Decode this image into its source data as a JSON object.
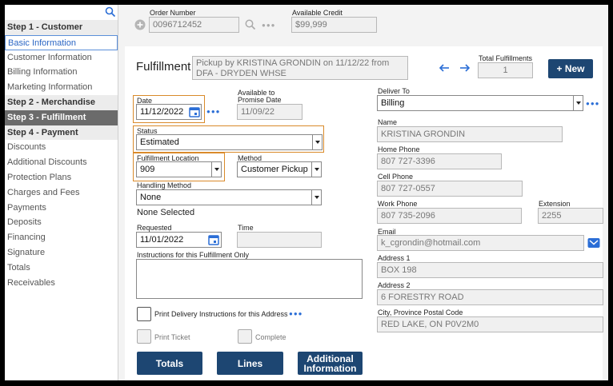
{
  "sidebar": {
    "items": [
      {
        "label": "Step 1 - Customer",
        "kind": "step"
      },
      {
        "label": "Basic Information",
        "kind": "selected"
      },
      {
        "label": "Customer Information",
        "kind": "item"
      },
      {
        "label": "Billing Information",
        "kind": "item"
      },
      {
        "label": "Marketing Information",
        "kind": "item"
      },
      {
        "label": "Step 2 - Merchandise",
        "kind": "step"
      },
      {
        "label": "Step 3 - Fulfillment",
        "kind": "active-step"
      },
      {
        "label": "Step 4 - Payment",
        "kind": "step"
      },
      {
        "label": "Discounts",
        "kind": "item"
      },
      {
        "label": "Additional Discounts",
        "kind": "item"
      },
      {
        "label": "Protection Plans",
        "kind": "item"
      },
      {
        "label": "Charges and Fees",
        "kind": "item"
      },
      {
        "label": "Payments",
        "kind": "item"
      },
      {
        "label": "Deposits",
        "kind": "item"
      },
      {
        "label": "Financing",
        "kind": "item"
      },
      {
        "label": "Signature",
        "kind": "item"
      },
      {
        "label": "Totals",
        "kind": "item"
      },
      {
        "label": "Receivables",
        "kind": "item"
      }
    ]
  },
  "header": {
    "order_number_label": "Order Number",
    "order_number": "0096712452",
    "available_credit_label": "Available Credit",
    "available_credit": "$99,999"
  },
  "fulfillment": {
    "title": "Fulfillment",
    "description": "Pickup by KRISTINA GRONDIN on 11/12/22 from DFA - DRYDEN WHSE",
    "total_label": "Total Fulfillments",
    "total": "1",
    "new_button": "+ New"
  },
  "form": {
    "date_label": "Date",
    "date": "11/12/2022",
    "promise_label_1": "Available to",
    "promise_label_2": "Promise Date",
    "promise_date": "11/09/22",
    "status_label": "Status",
    "status": "Estimated",
    "location_label": "Fulfillment Location",
    "location": "909",
    "method_label": "Method",
    "method": "Customer Pickup",
    "handling_label": "Handling Method",
    "handling": "None",
    "none_selected": "None Selected",
    "requested_label": "Requested",
    "requested": "11/01/2022",
    "time_label": "Time",
    "time": "",
    "instructions_label": "Instructions for this Fulfillment Only",
    "print_delivery_label": "Print Delivery Instructions for this Address",
    "print_ticket_label": "Print Ticket",
    "complete_label": "Complete"
  },
  "deliver": {
    "deliver_to_label": "Deliver To",
    "deliver_to": "Billing",
    "name_label": "Name",
    "name": "KRISTINA GRONDIN",
    "home_phone_label": "Home Phone",
    "home_phone": "807 727-3396",
    "cell_phone_label": "Cell Phone",
    "cell_phone": "807 727-0557",
    "work_phone_label": "Work Phone",
    "work_phone": "807 735-2096",
    "extension_label": "Extension",
    "extension": "2255",
    "email_label": "Email",
    "email": "k_cgrondin@hotmail.com",
    "address1_label": "Address 1",
    "address1": "BOX 198",
    "address2_label": "Address 2",
    "address2": "6 FORESTRY ROAD",
    "city_label": "City, Province Postal Code",
    "city": "RED LAKE, ON P0V2M0"
  },
  "buttons": {
    "totals": "Totals",
    "lines": "Lines",
    "additional_1": "Additional",
    "additional_2": "Information"
  },
  "colors": {
    "accent": "#1d4672",
    "link_blue": "#2b6ed6",
    "highlight": "#d98a2a",
    "active_step": "#6b6b6b"
  }
}
